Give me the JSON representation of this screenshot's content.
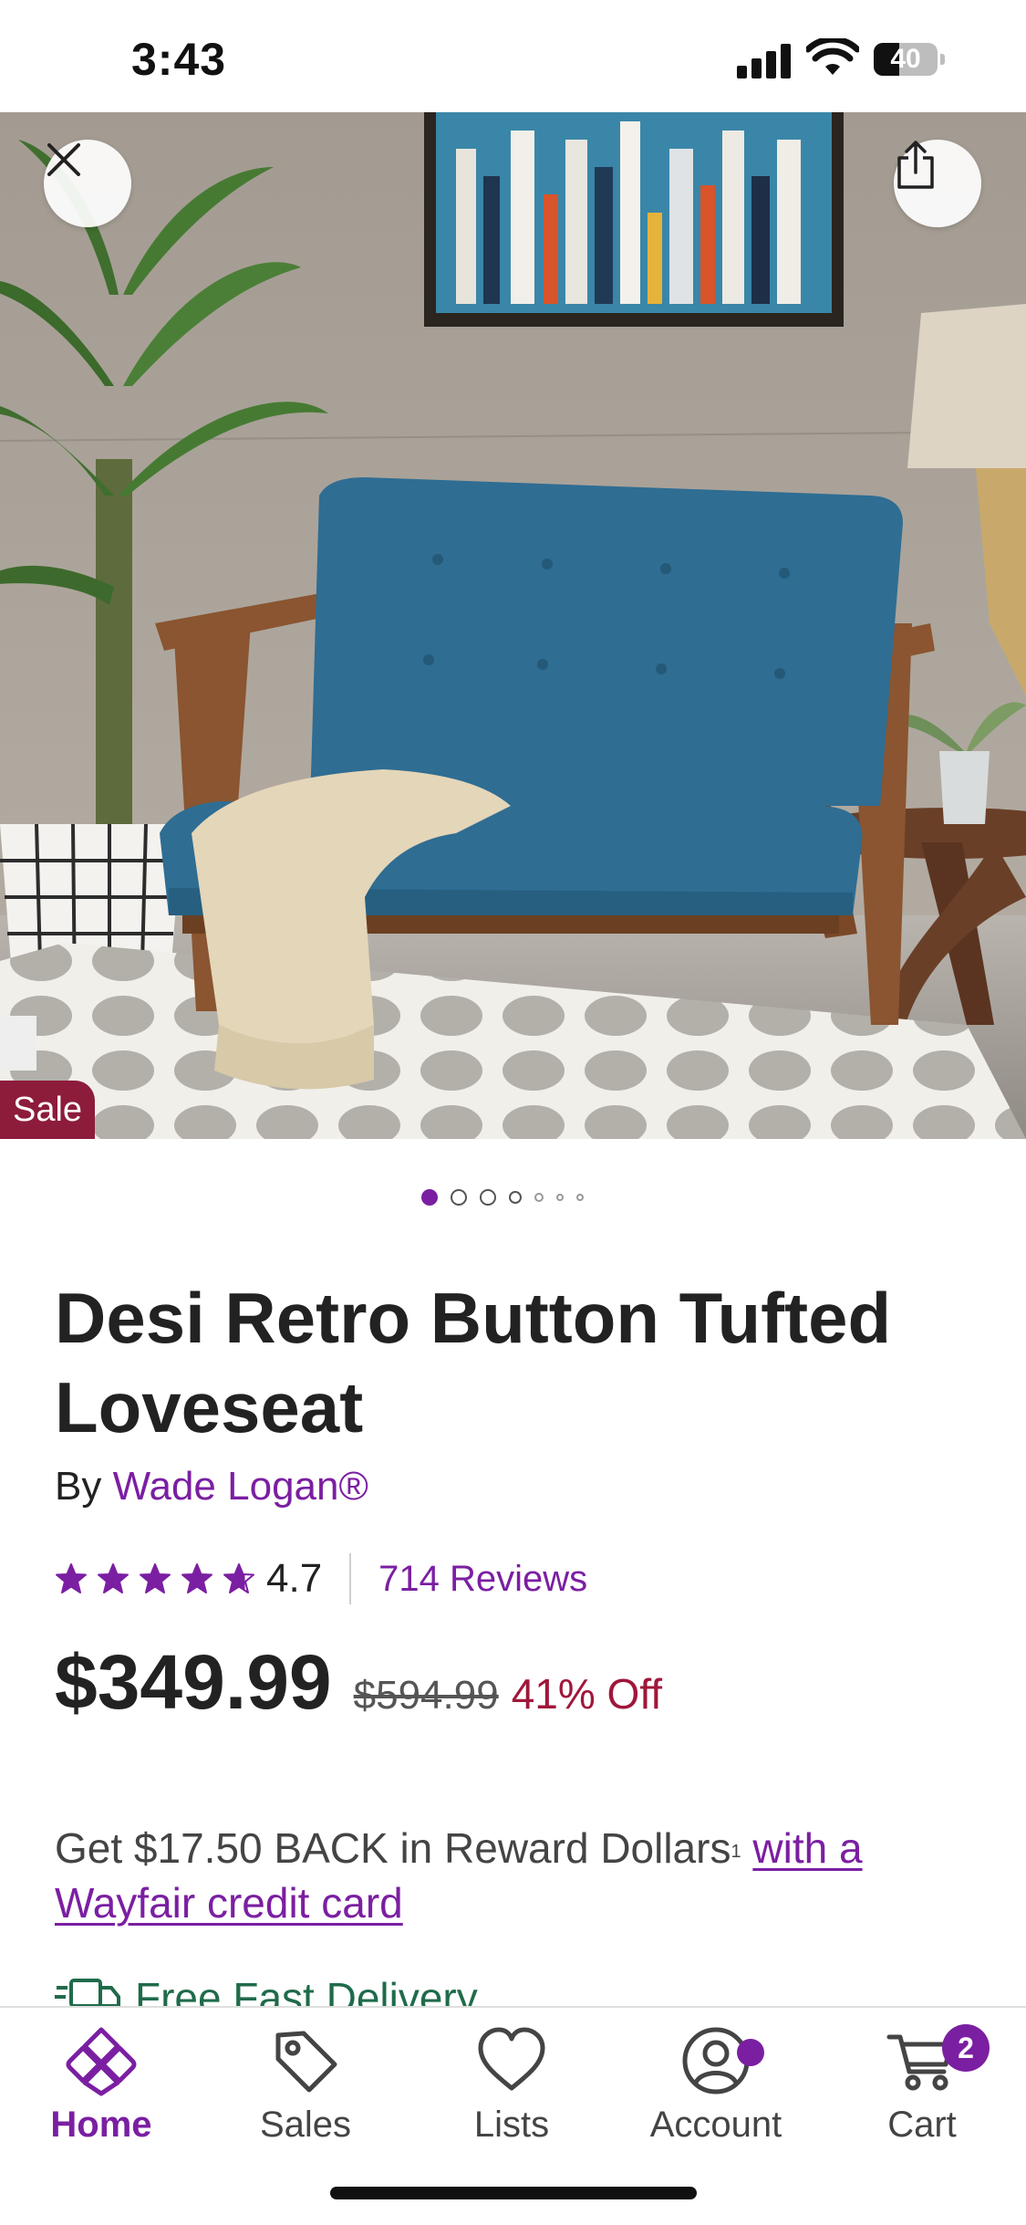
{
  "status_bar": {
    "time": "3:43",
    "battery": "40",
    "battery_level": 0.4
  },
  "product": {
    "sale_badge": "Sale",
    "image_count": 7,
    "current_image": 0,
    "title": "Desi Retro Button Tufted Loveseat",
    "by_prefix": "By",
    "brand": "Wade Logan®",
    "rating": "4.7",
    "rating_value": 4.7,
    "reviews": "714 Reviews",
    "price": "$349.99",
    "original_price": "$594.99",
    "discount": "41% Off",
    "reward_text": "Get $17.50 BACK in Reward Dollars",
    "reward_footnote": "1",
    "reward_link": "with a Wayfair credit card",
    "delivery": "Free Fast Delivery"
  },
  "icons": {
    "close": "close-icon",
    "share": "share-icon",
    "delivery": "truck-icon",
    "star": "star-icon"
  },
  "nav": {
    "items": [
      {
        "label": "Home",
        "icon": "home-icon",
        "active": true
      },
      {
        "label": "Sales",
        "icon": "tag-icon",
        "active": false
      },
      {
        "label": "Lists",
        "icon": "heart-icon",
        "active": false
      },
      {
        "label": "Account",
        "icon": "account-icon",
        "active": false
      },
      {
        "label": "Cart",
        "icon": "cart-icon",
        "active": false
      }
    ],
    "cart_count": "2"
  },
  "colors": {
    "accent": "#7b1fa2",
    "sale": "#8c1c3a",
    "discount": "#a0173a",
    "delivery": "#1f6b4a"
  }
}
